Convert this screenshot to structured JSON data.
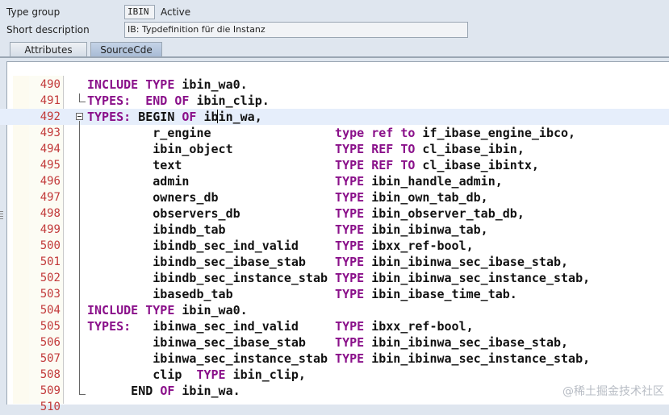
{
  "header": {
    "type_group_label": "Type group",
    "type_group_value": "IBIN",
    "status": "Active",
    "short_description_label": "Short description",
    "short_description_value": "IB: Typdefinition für die Instanz"
  },
  "tabs": [
    {
      "label": "Attributes"
    },
    {
      "label": "SourceCde"
    }
  ],
  "editor": {
    "lines": [
      {
        "no": "490",
        "tokens": [
          {
            "t": "INCLUDE ",
            "k": true
          },
          {
            "t": "TYPE ",
            "k": true
          },
          {
            "t": "ibin_wa0.",
            "k": false
          }
        ]
      },
      {
        "no": "491",
        "tokens": [
          {
            "t": "TYPES:  ",
            "k": true
          },
          {
            "t": "END ",
            "k": true
          },
          {
            "t": "OF ",
            "k": true
          },
          {
            "t": "ibin_clip.",
            "k": false
          }
        ]
      },
      {
        "no": "492",
        "tokens": [
          {
            "t": "TYPES: ",
            "k": true
          },
          {
            "t": "BEGIN ",
            "k": false
          },
          {
            "t": "OF ",
            "k": true
          },
          {
            "t": "ibin_wa,",
            "k": false
          }
        ]
      },
      {
        "no": "493",
        "tokens": [
          {
            "t": "         r_engine                 ",
            "k": false
          },
          {
            "t": "type ",
            "k": true
          },
          {
            "t": "ref ",
            "k": true
          },
          {
            "t": "to ",
            "k": true
          },
          {
            "t": "if_ibase_engine_ibco,",
            "k": false
          }
        ]
      },
      {
        "no": "494",
        "tokens": [
          {
            "t": "         ibin_object              ",
            "k": false
          },
          {
            "t": "TYPE ",
            "k": true
          },
          {
            "t": "REF ",
            "k": true
          },
          {
            "t": "TO ",
            "k": true
          },
          {
            "t": "cl_ibase_ibin,",
            "k": false
          }
        ]
      },
      {
        "no": "495",
        "tokens": [
          {
            "t": "         text                     ",
            "k": false
          },
          {
            "t": "TYPE ",
            "k": true
          },
          {
            "t": "REF ",
            "k": true
          },
          {
            "t": "TO ",
            "k": true
          },
          {
            "t": "cl_ibase_ibintx,",
            "k": false
          }
        ]
      },
      {
        "no": "496",
        "tokens": [
          {
            "t": "         admin                    ",
            "k": false
          },
          {
            "t": "TYPE ",
            "k": true
          },
          {
            "t": "ibin_handle_admin,",
            "k": false
          }
        ]
      },
      {
        "no": "497",
        "tokens": [
          {
            "t": "         owners_db                ",
            "k": false
          },
          {
            "t": "TYPE ",
            "k": true
          },
          {
            "t": "ibin_own_tab_db,",
            "k": false
          }
        ]
      },
      {
        "no": "498",
        "tokens": [
          {
            "t": "         observers_db             ",
            "k": false
          },
          {
            "t": "TYPE ",
            "k": true
          },
          {
            "t": "ibin_observer_tab_db,",
            "k": false
          }
        ]
      },
      {
        "no": "499",
        "tokens": [
          {
            "t": "         ibindb_tab               ",
            "k": false
          },
          {
            "t": "TYPE ",
            "k": true
          },
          {
            "t": "ibin_ibinwa_tab,",
            "k": false
          }
        ]
      },
      {
        "no": "500",
        "tokens": [
          {
            "t": "         ibindb_sec_ind_valid     ",
            "k": false
          },
          {
            "t": "TYPE ",
            "k": true
          },
          {
            "t": "ibxx_ref-bool,",
            "k": false
          }
        ]
      },
      {
        "no": "501",
        "tokens": [
          {
            "t": "         ibindb_sec_ibase_stab    ",
            "k": false
          },
          {
            "t": "TYPE ",
            "k": true
          },
          {
            "t": "ibin_ibinwa_sec_ibase_stab,",
            "k": false
          }
        ]
      },
      {
        "no": "502",
        "tokens": [
          {
            "t": "         ibindb_sec_instance_stab ",
            "k": false
          },
          {
            "t": "TYPE ",
            "k": true
          },
          {
            "t": "ibin_ibinwa_sec_instance_stab,",
            "k": false
          }
        ]
      },
      {
        "no": "503",
        "tokens": [
          {
            "t": "         ibasedb_tab              ",
            "k": false
          },
          {
            "t": "TYPE ",
            "k": true
          },
          {
            "t": "ibin_ibase_time_tab.",
            "k": false
          }
        ]
      },
      {
        "no": "504",
        "tokens": [
          {
            "t": "INCLUDE ",
            "k": true
          },
          {
            "t": "TYPE ",
            "k": true
          },
          {
            "t": "ibin_wa0.",
            "k": false
          }
        ]
      },
      {
        "no": "505",
        "tokens": [
          {
            "t": "TYPES:   ",
            "k": true
          },
          {
            "t": "ibinwa_sec_ind_valid     ",
            "k": false
          },
          {
            "t": "TYPE ",
            "k": true
          },
          {
            "t": "ibxx_ref-bool,",
            "k": false
          }
        ]
      },
      {
        "no": "506",
        "tokens": [
          {
            "t": "         ibinwa_sec_ibase_stab    ",
            "k": false
          },
          {
            "t": "TYPE ",
            "k": true
          },
          {
            "t": "ibin_ibinwa_sec_ibase_stab,",
            "k": false
          }
        ]
      },
      {
        "no": "507",
        "tokens": [
          {
            "t": "         ibinwa_sec_instance_stab ",
            "k": false
          },
          {
            "t": "TYPE ",
            "k": true
          },
          {
            "t": "ibin_ibinwa_sec_instance_stab,",
            "k": false
          }
        ]
      },
      {
        "no": "508",
        "tokens": [
          {
            "t": "         clip  ",
            "k": false
          },
          {
            "t": "TYPE ",
            "k": true
          },
          {
            "t": "ibin_clip,",
            "k": false
          }
        ]
      },
      {
        "no": "509",
        "tokens": [
          {
            "t": "      END ",
            "k": false
          },
          {
            "t": "OF ",
            "k": true
          },
          {
            "t": "ibin_wa.",
            "k": false
          }
        ]
      },
      {
        "no": "510",
        "tokens": []
      }
    ],
    "highlighted_line": "492"
  },
  "watermark": "@稀土掘金技术社区",
  "colors": {
    "keyword": "#8a108a",
    "line_number": "#c23a3a",
    "highlight": "#e6eefb",
    "background": "#dfe6ef"
  }
}
